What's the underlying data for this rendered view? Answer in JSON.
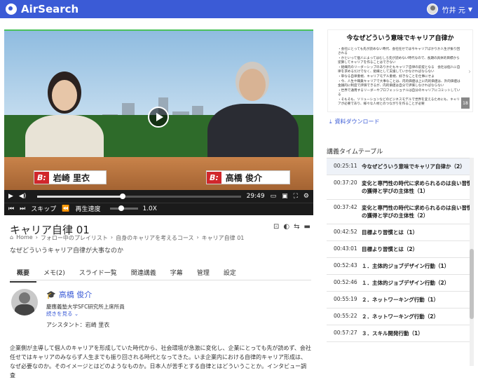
{
  "app": {
    "name": "AirSearch"
  },
  "user": {
    "name": "竹井 元"
  },
  "video": {
    "nameplate_left": "岩崎 里衣",
    "nameplate_right": "高橋 俊介",
    "nameplate_logo": "B:",
    "time": "29:49",
    "skip_label": "スキップ",
    "speed_label": "再生速度",
    "speed_value": "1.0X",
    "progress": 0.42
  },
  "lecture": {
    "title": "キャリア自律 01",
    "breadcrumbs": [
      "Home",
      "フォロー中のプレイリスト",
      "自身のキャリアを考えるコース",
      "キャリア自律 01"
    ],
    "subtitle": "なぜどういうキャリア自律が大事なのか",
    "tabs": [
      "概要",
      "メモ(2)",
      "スライド一覧",
      "関連講義",
      "字幕",
      "管理",
      "設定"
    ],
    "lecturer_name": "高橋 俊介",
    "lecturer_affiliation": "慶應義塾大学SFC研究所上席所員",
    "more_label": "続きを見る",
    "assistant": "アシスタント：岩崎 里衣",
    "description": "企業側が主導して個人のキャリアを形成していた時代から、社会環境が急激に変化し、企業にとっても先が読めず、会社任せではキャリアのみならず人生までも振り回される時代となってきた。いま企業内における自律的キャリア形成は、なぜ必要なのか。そのイメージとはどのようなものか。日本人が苦手とする自律とはどういうことか。インタビュー調査"
  },
  "slide": {
    "title": "今なぜどういう意味でキャリア自律か",
    "bullets": [
      "会社にとっても先が読めない時代、会社任せでは今キャリアばかりか人生が振り回される",
      "かといって個人によってはむしろ先が読めない時代なので、長期の具体的目標から逆算してキャリアを作ることはできない",
      "組織内のリーダーシップのありかたもキャリア自律の前提となる　会社は個人に自律を求めるだけでなく、組織として支援していかなければならない",
      "単なる自律重視、キャリアモデル重視、好きなことを仕事にせよ",
      "今、人生や職業キャリアで大事なことは、内的価値は上に内的価値は、外的価値は金銭的に制度で評価できるが、内的価値は自分で評価しなければならない",
      "世界で通用するリーダーやプロフェッショナルは自分のキャリアにコミットしている",
      "そもそも、ソリューションなどのビジネスモデルで世界を変えるためにも、キャリアが必要であり、様々な人材とのつながりを作ることが必要"
    ],
    "page_number": "18",
    "download_label": "資料ダウンロード"
  },
  "timeline": {
    "title": "講義タイムテーブル",
    "items": [
      {
        "time": "00:25:11",
        "text": "今なぜどういう意味でキャリア自律か（2）"
      },
      {
        "time": "00:37:20",
        "text": "変化と専門性の時代に求められるのは良い習慣の獲得と学びの主体性（1）"
      },
      {
        "time": "00:37:42",
        "text": "変化と専門性の時代に求められるのは良い習慣の獲得と学びの主体性（2）"
      },
      {
        "time": "00:42:52",
        "text": "目標より習慣とは（1）"
      },
      {
        "time": "00:43:01",
        "text": "目標より習慣とは（2）"
      },
      {
        "time": "00:52:43",
        "text": "１．主体的ジョブデザイン行動（1）"
      },
      {
        "time": "00:52:46",
        "text": "１．主体的ジョブデザイン行動（2）"
      },
      {
        "time": "00:55:19",
        "text": "２．ネットワーキング行動（1）"
      },
      {
        "time": "00:55:22",
        "text": "２．ネットワーキング行動（2）"
      },
      {
        "time": "00:57:27",
        "text": "３．スキル開発行動（1）"
      }
    ]
  }
}
